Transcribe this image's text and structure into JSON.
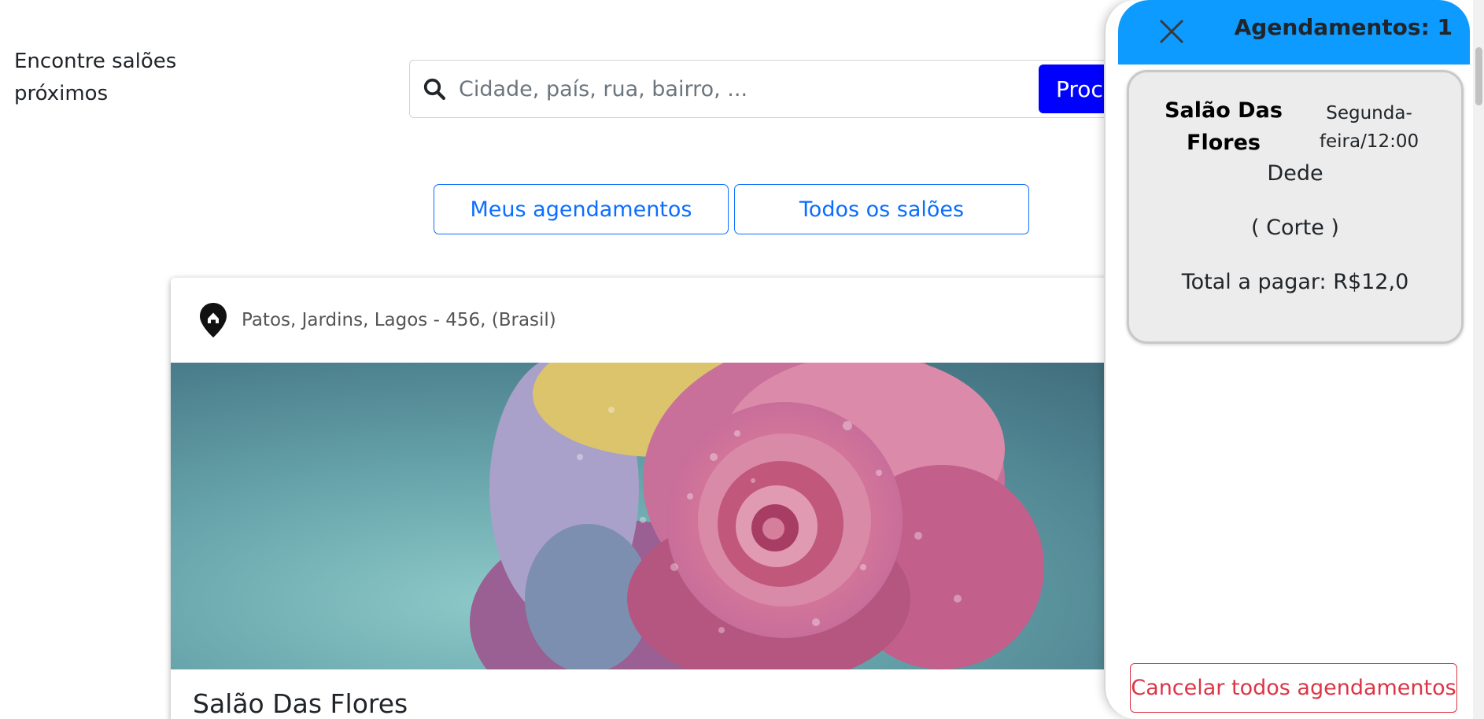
{
  "main": {
    "find_label": "Encontre salões próximos",
    "search": {
      "placeholder": "Cidade, país, rua, bairro, ...",
      "value": "",
      "button_label": "Procurar"
    },
    "filters": {
      "my_bookings": "Meus agendamentos",
      "all_salons": "Todos os salões"
    },
    "salon_card": {
      "address": "Patos, Jardins, Lagos - 456, (Brasil)",
      "name": "Salão Das Flores",
      "image_subject": "rose-photo"
    }
  },
  "drawer": {
    "title": "Agendamentos: 1",
    "booking": {
      "salon": "Salão Das Flores",
      "datetime": "Segunda-feira/12:00",
      "client": "Dede",
      "service": "( Corte )",
      "total": "Total a pagar: R$12,0"
    },
    "cancel_all_label": "Cancelar todos agendamentos"
  },
  "colors": {
    "primary": "#0d6efd",
    "search_button": "#0000ff",
    "drawer_header": "#0d9bff",
    "danger": "#dc3545",
    "booking_card_bg": "#ececec"
  },
  "icons": [
    "search-icon",
    "location-pin-icon",
    "close-icon"
  ]
}
